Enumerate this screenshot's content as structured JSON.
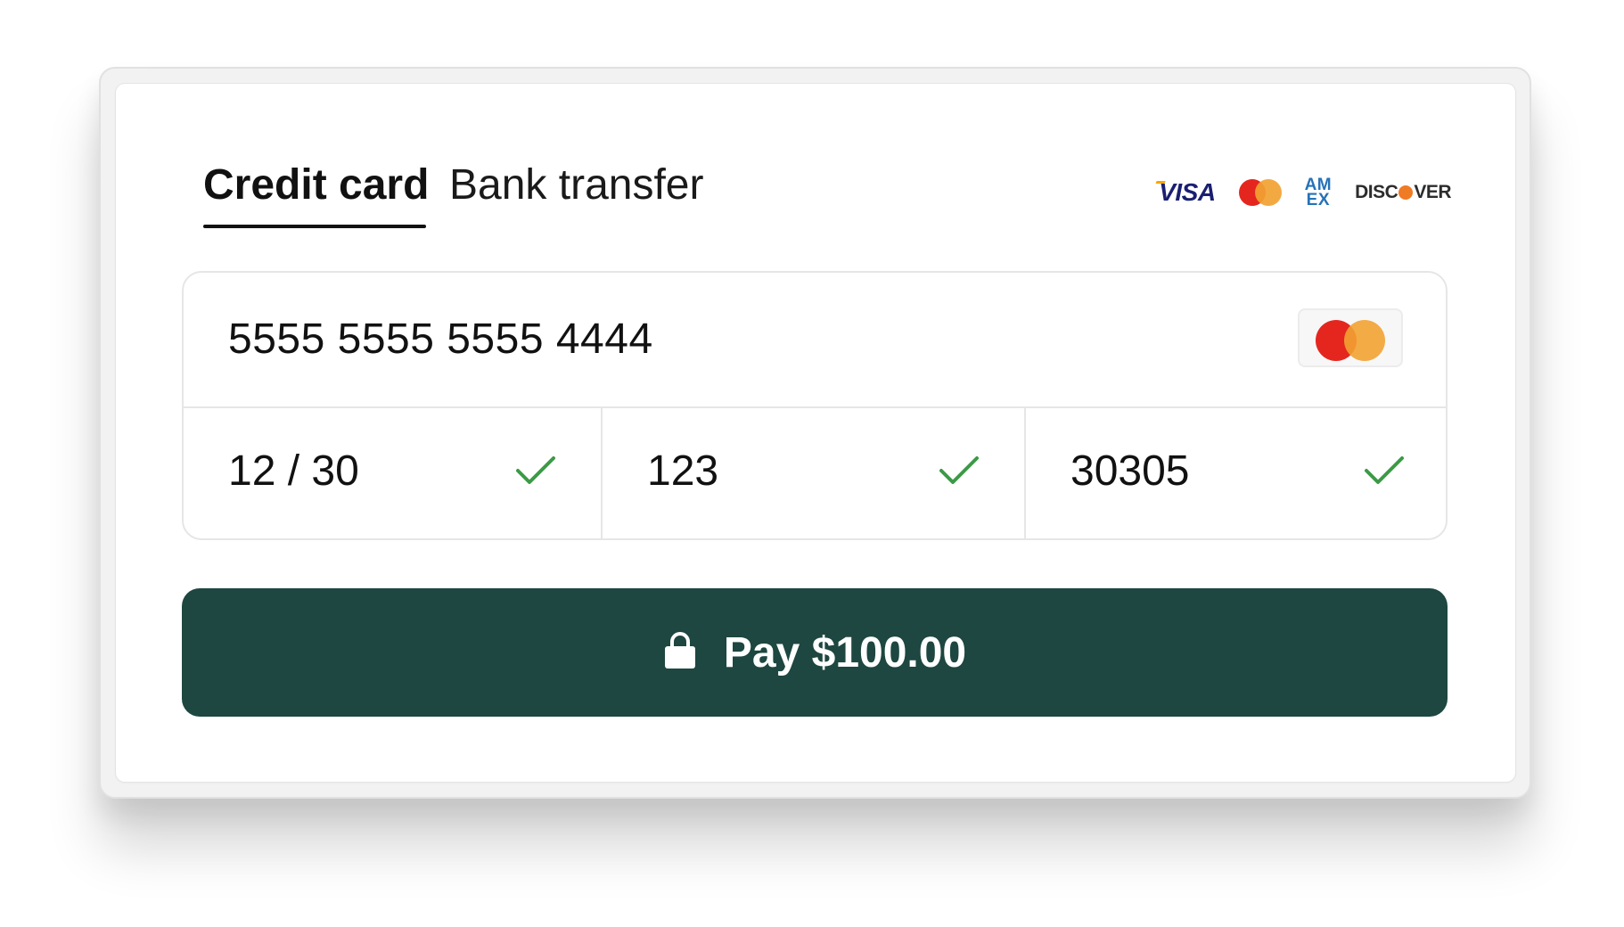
{
  "tabs": [
    {
      "label": "Credit card",
      "active": true
    },
    {
      "label": "Bank transfer",
      "active": false
    }
  ],
  "accepted_brands": {
    "visa": "VISA",
    "mastercard_icon": "mastercard-logo-icon",
    "amex_line1": "AM",
    "amex_line2": "EX",
    "discover_pre": "DISC",
    "discover_post": "VER"
  },
  "card_form": {
    "card_number": "5555 5555 5555 4444",
    "detected_brand_icon": "mastercard-logo-icon",
    "expiry": "12 / 30",
    "cvc": "123",
    "postal_code": "30305",
    "valid_icon": "check-icon"
  },
  "pay_button": {
    "label": "Pay $100.00",
    "icon": "lock-icon"
  },
  "colors": {
    "button_bg": "#1d4740",
    "check": "#3c9a46",
    "mastercard_red": "#e4261f",
    "mastercard_orange": "#f2a232"
  }
}
